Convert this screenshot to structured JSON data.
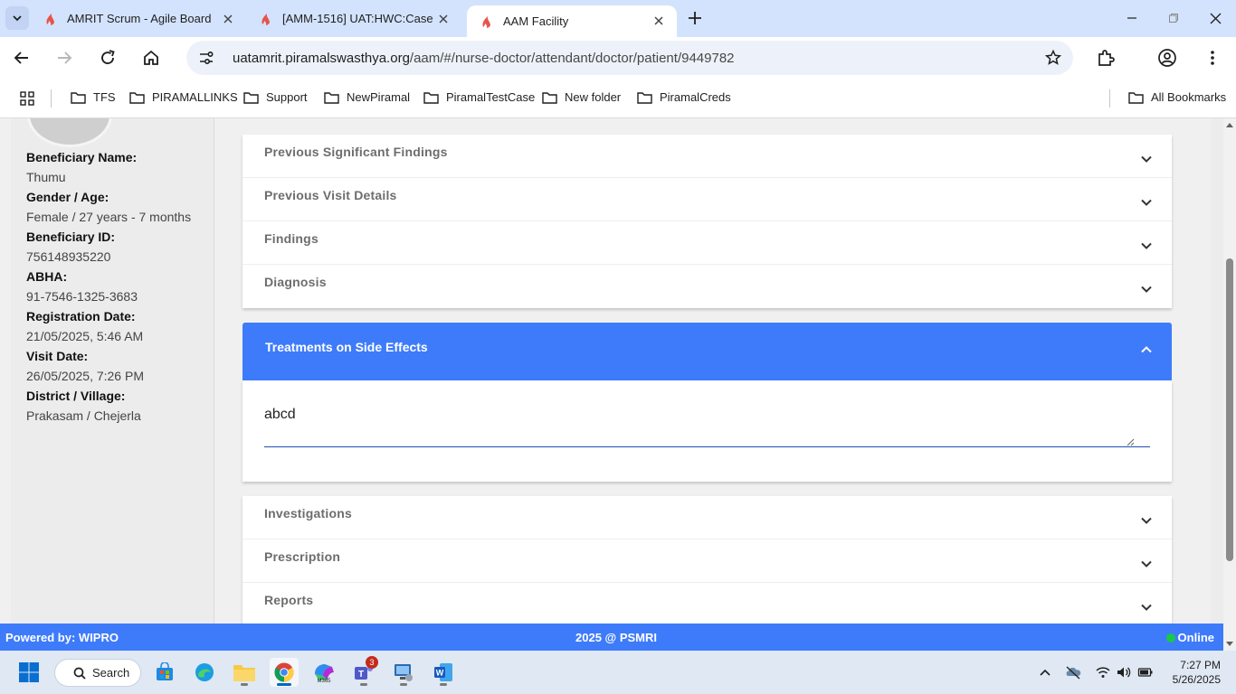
{
  "browser": {
    "tabs": [
      {
        "title": "AMRIT Scrum - Agile Board",
        "active": false
      },
      {
        "title": "[AMM-1516] UAT:HWC:Case",
        "active": false
      },
      {
        "title": "AAM Facility",
        "active": true
      }
    ],
    "url_host": "uatamrit.piramalswasthya.org",
    "url_path": "/aam/#/nurse-doctor/attendant/doctor/patient/9449782",
    "bookmarks": [
      "TFS",
      "PIRAMALLINKS",
      "Support",
      "NewPiramal",
      "PiramalTestCase",
      "New folder",
      "PiramalCreds"
    ],
    "all_bookmarks": "All Bookmarks"
  },
  "beneficiary": {
    "name_label": "Beneficiary Name:",
    "name": "Thumu",
    "gender_age_label": "Gender / Age:",
    "gender_age": "Female / 27 years - 7 months",
    "id_label": "Beneficiary ID:",
    "id": "756148935220",
    "abha_label": "ABHA:",
    "abha": "91-7546-1325-3683",
    "reg_date_label": "Registration Date:",
    "reg_date": "21/05/2025, 5:46 AM",
    "visit_date_label": "Visit Date:",
    "visit_date": "26/05/2025, 7:26 PM",
    "district_label": "District / Village:",
    "district": "Prakasam / Chejerla"
  },
  "sections_top": [
    "Previous Significant Findings",
    "Previous Visit Details",
    "Findings",
    "Diagnosis"
  ],
  "expanded_section": {
    "title": "Treatments on Side Effects",
    "value": "abcd"
  },
  "sections_bottom": [
    "Investigations",
    "Prescription",
    "Reports"
  ],
  "footer": {
    "powered_by": "Powered by: WIPRO",
    "copyright": "2025 @ PSMRI",
    "status": "Online"
  },
  "taskbar": {
    "search_label": "Search",
    "teams_badge": "3",
    "time": "7:27 PM",
    "date": "5/26/2025"
  },
  "colors": {
    "accent": "#3e7bfa",
    "online": "#19c94a",
    "tabstrip": "#d3e3fd"
  }
}
